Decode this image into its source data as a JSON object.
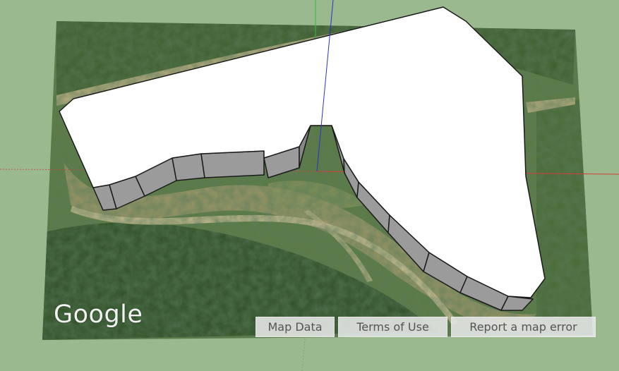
{
  "colors": {
    "background": "#9ab98e",
    "model_face": "#ffffff",
    "wall_face": "#9b9b9b",
    "edge": "#1a1a1a",
    "axis_red": "#d43c3c",
    "axis_green": "#3bb53b",
    "axis_blue": "#2a33c8"
  },
  "map": {
    "provider_logo": "Google",
    "attribution": {
      "map_data": "Map Data",
      "terms": "Terms of Use",
      "report": "Report a map error"
    }
  }
}
